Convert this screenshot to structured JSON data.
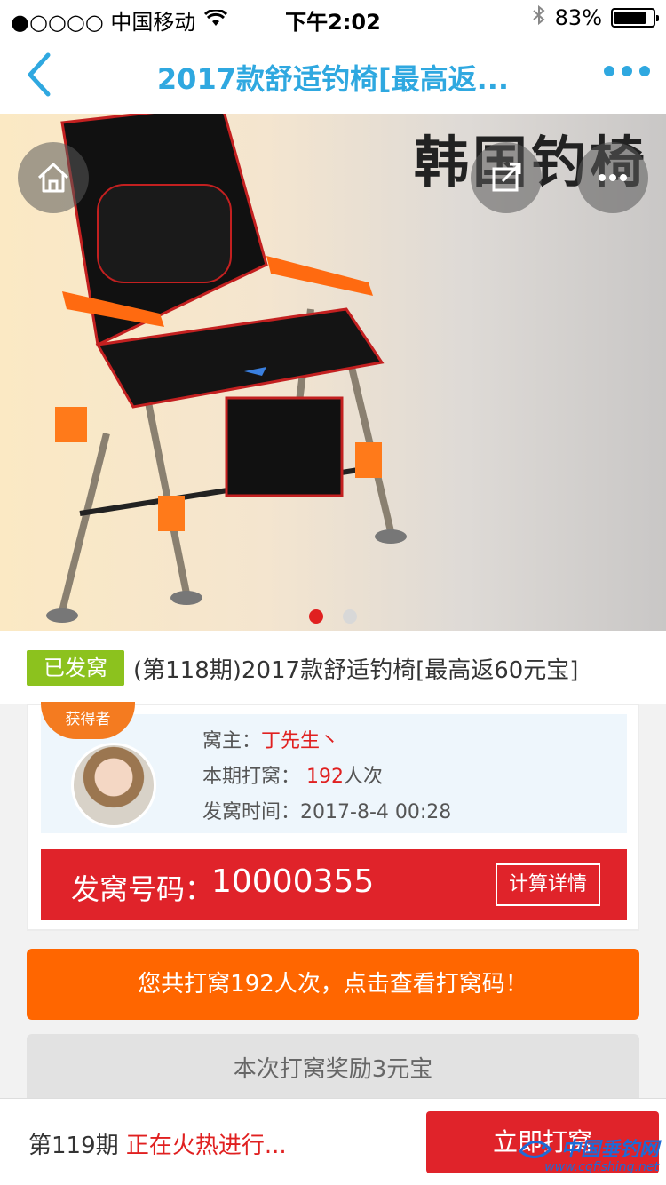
{
  "status_bar": {
    "carrier": "●○○○○ 中国移动",
    "time": "下午2:02",
    "battery": "83%",
    "battery_level": 0.83
  },
  "nav": {
    "title": "2017款舒适钓椅[最高返..."
  },
  "hero": {
    "brand_text": "韩国钓椅",
    "slides_total": 2,
    "active_slide": 1
  },
  "product": {
    "status_badge": "已发窝",
    "title": "(第118期)2017款舒适钓椅[最高返60元宝]"
  },
  "winner": {
    "ribbon": "获得者",
    "owner_label": "窝主：",
    "owner_name": "丁先生丶",
    "count_label": "本期打窝：",
    "count_value": "192",
    "count_unit": "人次",
    "time_label": "发窝时间：",
    "time_value": "2017-8-4 00:28",
    "code_label": "发窝号码：",
    "code_value": "10000355",
    "calc_button": "计算详情"
  },
  "actions": {
    "view_codes": "您共打窝192人次，点击查看打窝码！",
    "reward": "本次打窝奖励3元宝"
  },
  "bottom": {
    "period": "第119期",
    "status": "正在火热进行...",
    "join_button": "立即打窝",
    "watermark_title": "中国垂钓网",
    "watermark_url": "www.cqfishing.net"
  },
  "colors": {
    "accent_blue": "#2fa8e0",
    "red": "#e0232a",
    "orange": "#ff6600",
    "green": "#8cc21e"
  }
}
